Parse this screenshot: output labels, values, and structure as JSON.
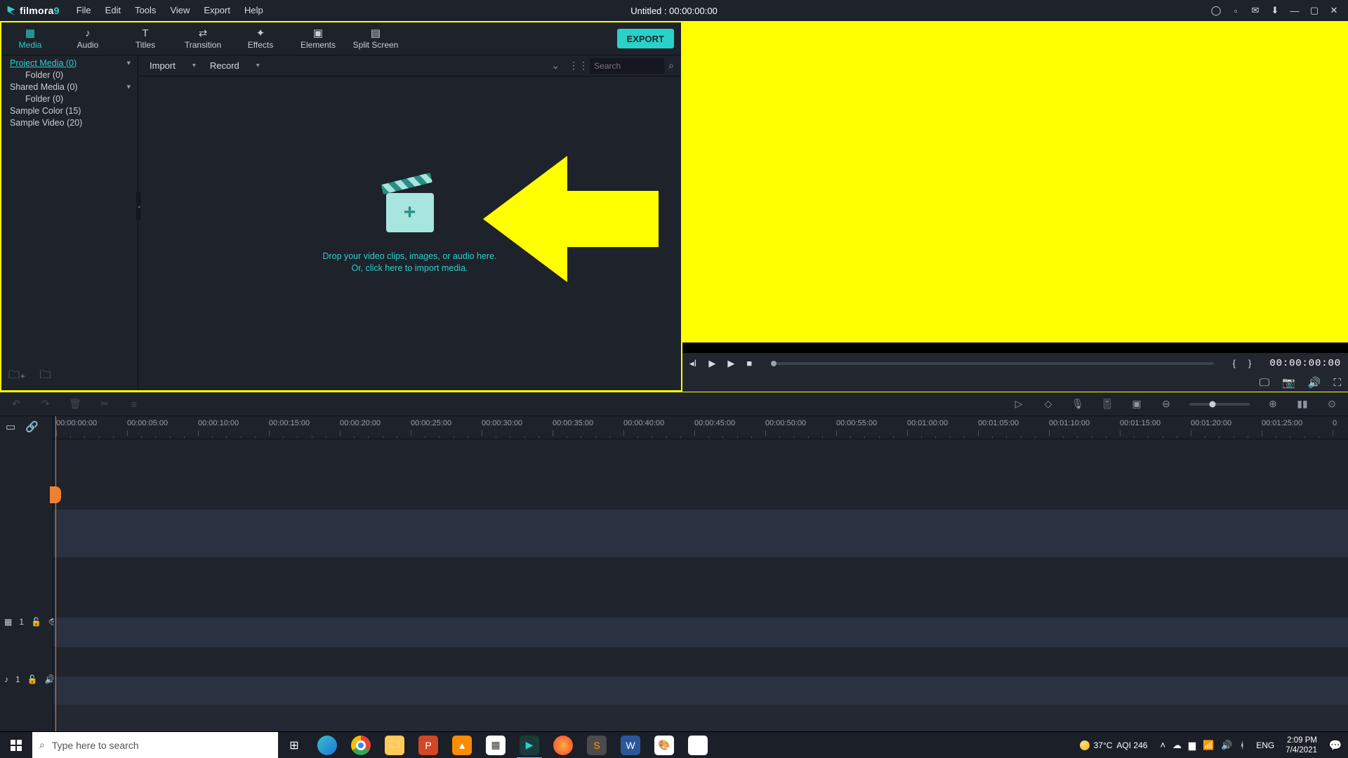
{
  "app": {
    "name_base": "filmora",
    "name_suffix": "9",
    "title": "Untitled : 00:00:00:00"
  },
  "menu": [
    "File",
    "Edit",
    "Tools",
    "View",
    "Export",
    "Help"
  ],
  "title_icons": [
    "account",
    "save",
    "message",
    "download",
    "minimize",
    "maximize",
    "close"
  ],
  "tabs": [
    {
      "label": "Media",
      "icon": "▦"
    },
    {
      "label": "Audio",
      "icon": "♪"
    },
    {
      "label": "Titles",
      "icon": "T"
    },
    {
      "label": "Transition",
      "icon": "⇄"
    },
    {
      "label": "Effects",
      "icon": "✦"
    },
    {
      "label": "Elements",
      "icon": "▣"
    },
    {
      "label": "Split Screen",
      "icon": "▤"
    }
  ],
  "active_tab": "Media",
  "export_label": "EXPORT",
  "media_tree": [
    {
      "label": "Project Media (0)",
      "sel": true,
      "chev": true
    },
    {
      "label": "Folder (0)",
      "indent": true
    },
    {
      "label": "Shared Media (0)",
      "chev": true
    },
    {
      "label": "Folder (0)",
      "indent": true
    },
    {
      "label": "Sample Color (15)"
    },
    {
      "label": "Sample Video (20)"
    }
  ],
  "bin_toolbar": {
    "import": "Import",
    "record": "Record",
    "search_placeholder": "Search"
  },
  "drop": {
    "l1": "Drop your video clips, images, or audio here.",
    "l2": "Or, click here to import media."
  },
  "preview": {
    "time": "00:00:00:00"
  },
  "timeline": {
    "ticks": [
      "00:00:00:00",
      "00:00:05:00",
      "00:00:10:00",
      "00:00:15:00",
      "00:00:20:00",
      "00:00:25:00",
      "00:00:30:00",
      "00:00:35:00",
      "00:00:40:00",
      "00:00:45:00",
      "00:00:50:00",
      "00:00:55:00",
      "00:01:00:00",
      "00:01:05:00",
      "00:01:10:00",
      "00:01:15:00",
      "00:01:20:00",
      "00:01:25:00"
    ],
    "track_video_label": "1",
    "track_audio_label": "1"
  },
  "taskbar": {
    "search_placeholder": "Type here to search",
    "weather": {
      "temp": "37°C",
      "aqi": "AQI 246"
    },
    "lang": "ENG",
    "time": "2:09 PM",
    "date": "7/4/2021"
  }
}
